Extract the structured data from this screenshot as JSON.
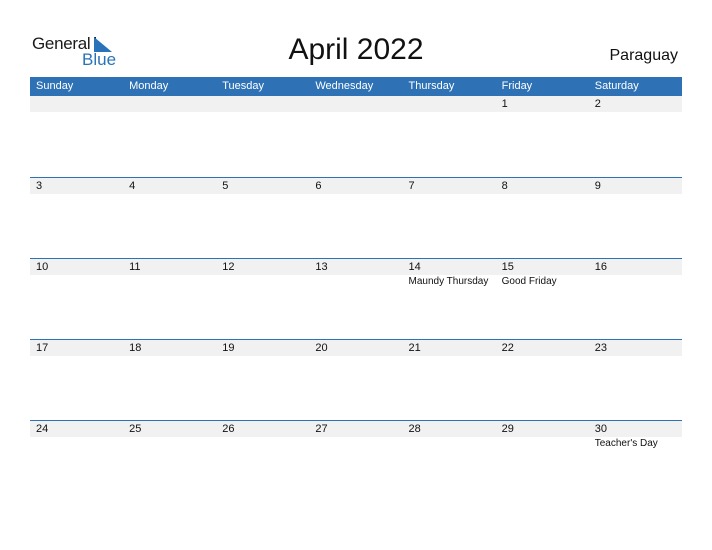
{
  "logo": {
    "line1": "General",
    "line2": "Blue"
  },
  "title": "April 2022",
  "country": "Paraguay",
  "colors": {
    "header": "#2e72b5",
    "band": "#f1f1f1",
    "brand": "#2a73b8"
  },
  "weekdays": [
    "Sunday",
    "Monday",
    "Tuesday",
    "Wednesday",
    "Thursday",
    "Friday",
    "Saturday"
  ],
  "weeks": [
    [
      {
        "day": "",
        "holiday": ""
      },
      {
        "day": "",
        "holiday": ""
      },
      {
        "day": "",
        "holiday": ""
      },
      {
        "day": "",
        "holiday": ""
      },
      {
        "day": "",
        "holiday": ""
      },
      {
        "day": "1",
        "holiday": ""
      },
      {
        "day": "2",
        "holiday": ""
      }
    ],
    [
      {
        "day": "3",
        "holiday": ""
      },
      {
        "day": "4",
        "holiday": ""
      },
      {
        "day": "5",
        "holiday": ""
      },
      {
        "day": "6",
        "holiday": ""
      },
      {
        "day": "7",
        "holiday": ""
      },
      {
        "day": "8",
        "holiday": ""
      },
      {
        "day": "9",
        "holiday": ""
      }
    ],
    [
      {
        "day": "10",
        "holiday": ""
      },
      {
        "day": "11",
        "holiday": ""
      },
      {
        "day": "12",
        "holiday": ""
      },
      {
        "day": "13",
        "holiday": ""
      },
      {
        "day": "14",
        "holiday": "Maundy Thursday"
      },
      {
        "day": "15",
        "holiday": "Good Friday"
      },
      {
        "day": "16",
        "holiday": ""
      }
    ],
    [
      {
        "day": "17",
        "holiday": ""
      },
      {
        "day": "18",
        "holiday": ""
      },
      {
        "day": "19",
        "holiday": ""
      },
      {
        "day": "20",
        "holiday": ""
      },
      {
        "day": "21",
        "holiday": ""
      },
      {
        "day": "22",
        "holiday": ""
      },
      {
        "day": "23",
        "holiday": ""
      }
    ],
    [
      {
        "day": "24",
        "holiday": ""
      },
      {
        "day": "25",
        "holiday": ""
      },
      {
        "day": "26",
        "holiday": ""
      },
      {
        "day": "27",
        "holiday": ""
      },
      {
        "day": "28",
        "holiday": ""
      },
      {
        "day": "29",
        "holiday": ""
      },
      {
        "day": "30",
        "holiday": "Teacher's Day"
      }
    ]
  ]
}
